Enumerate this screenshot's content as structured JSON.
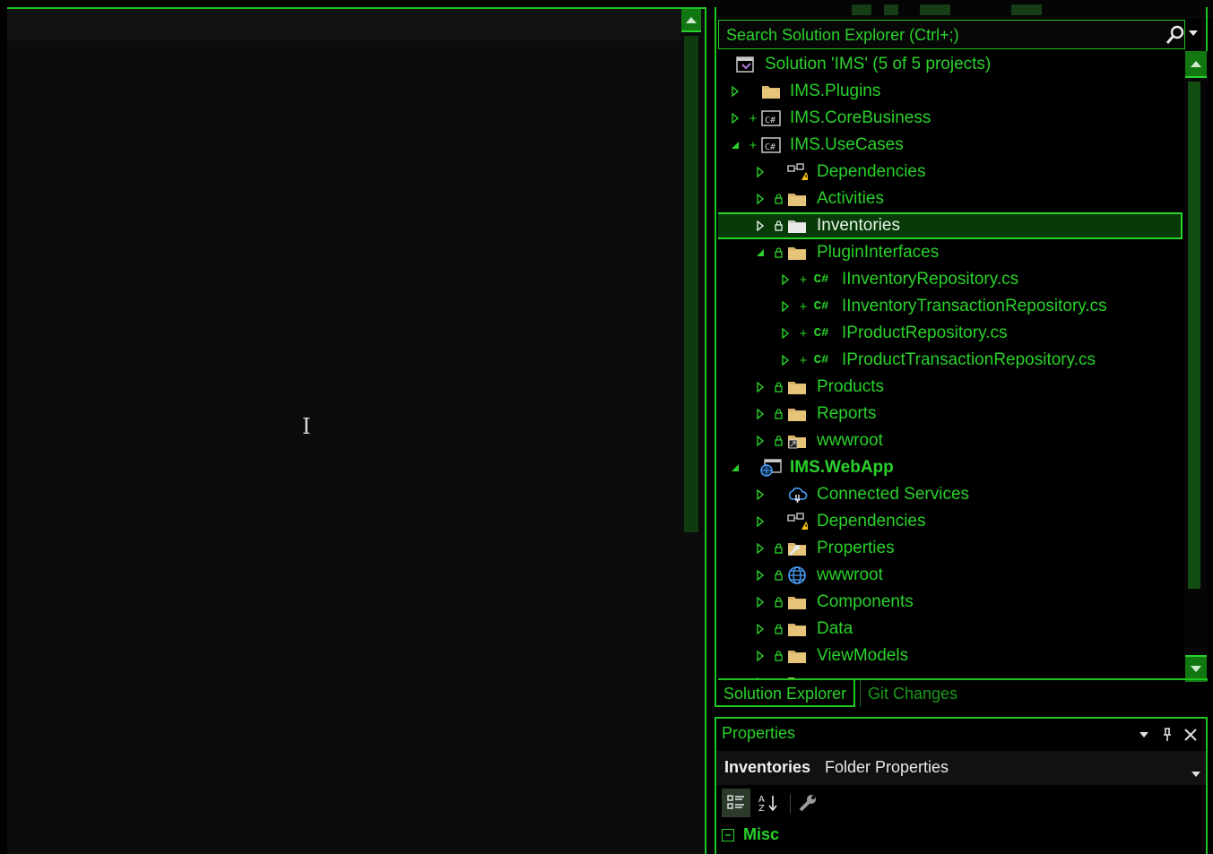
{
  "search": {
    "placeholder": "Search Solution Explorer (Ctrl+;)"
  },
  "tree": {
    "solution": "Solution 'IMS' (5 of 5 projects)",
    "plugins": "IMS.Plugins",
    "core": "IMS.CoreBusiness",
    "usecases": "IMS.UseCases",
    "uc_dependencies": "Dependencies",
    "uc_activities": "Activities",
    "uc_inventories": "Inventories",
    "uc_plugininterfaces": "PluginInterfaces",
    "pi_iinventoryrepo": "IInventoryRepository.cs",
    "pi_iinventorytxrepo": "IInventoryTransactionRepository.cs",
    "pi_iproductrepo": "IProductRepository.cs",
    "pi_iproducttxrepo": "IProductTransactionRepository.cs",
    "uc_products": "Products",
    "uc_reports": "Reports",
    "uc_wwwroot": "wwwroot",
    "webapp": "IMS.WebApp",
    "wa_connected": "Connected Services",
    "wa_dependencies": "Dependencies",
    "wa_properties": "Properties",
    "wa_wwwroot": "wwwroot",
    "wa_components": "Components",
    "wa_data": "Data",
    "wa_viewmodels": "ViewModels"
  },
  "tabs": {
    "solution_explorer": "Solution Explorer",
    "git_changes": "Git Changes"
  },
  "properties": {
    "title": "Properties",
    "object_name": "Inventories",
    "object_type": "Folder Properties",
    "category": "Misc"
  },
  "colors": {
    "accent": "#2bd12b",
    "background": "#000000",
    "selection": "#083a08",
    "folder": "#d8b46a"
  }
}
